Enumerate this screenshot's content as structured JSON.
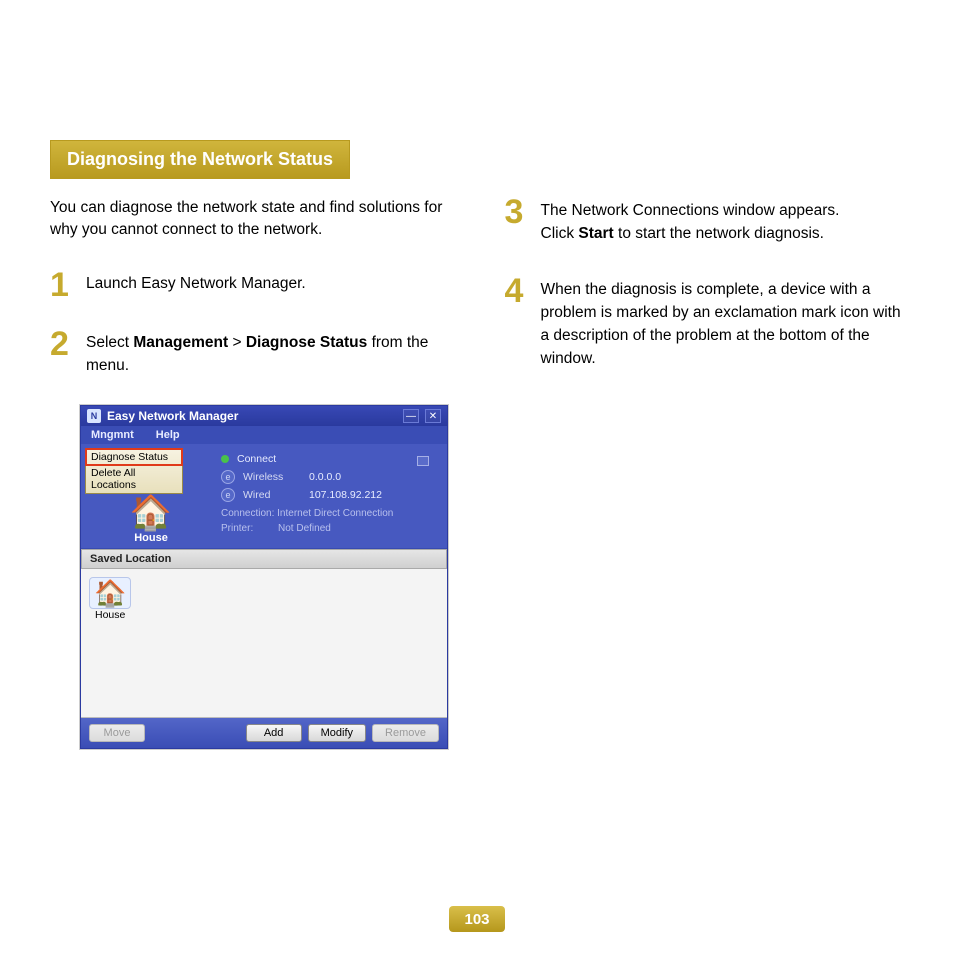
{
  "heading": "Diagnosing the Network Status",
  "intro": "You can diagnose the network state and find solutions for why you cannot connect to the network.",
  "steps": {
    "s1_num": "1",
    "s1_text": "Launch Easy Network Manager.",
    "s2_num": "2",
    "s2_pre": "Select ",
    "s2_b1": "Management",
    "s2_mid": " > ",
    "s2_b2": "Diagnose Status",
    "s2_post": " from the menu.",
    "s3_num": "3",
    "s3_line1": "The Network Connections window appears.",
    "s3_pre": "Click ",
    "s3_b": "Start",
    "s3_post": " to start the network diagnosis.",
    "s4_num": "4",
    "s4_text": "When the diagnosis is complete, a device with a problem is marked by an exclamation mark icon with a description of the problem at the bottom of the window."
  },
  "app": {
    "title": "Easy Network Manager",
    "menu": {
      "m1": "Mngmnt",
      "m2": "Help"
    },
    "dropdown": {
      "d1": "Diagnose Status",
      "d2": "Delete All Locations"
    },
    "house_label": "House",
    "connect": "Connect",
    "wireless_label": "Wireless",
    "wireless_val": "0.0.0.0",
    "wired_label": "Wired",
    "wired_val": "107.108.92.212",
    "conn_label": "Connection:",
    "conn_val": "Internet Direct Connection",
    "printer_label": "Printer:",
    "printer_val": "Not Defined",
    "saved_header": "Saved Location",
    "saved_item": "House",
    "buttons": {
      "move": "Move",
      "add": "Add",
      "modify": "Modify",
      "remove": "Remove"
    },
    "icons": {
      "app": "N",
      "ie": "e",
      "house": "🏠"
    }
  },
  "page_number": "103"
}
